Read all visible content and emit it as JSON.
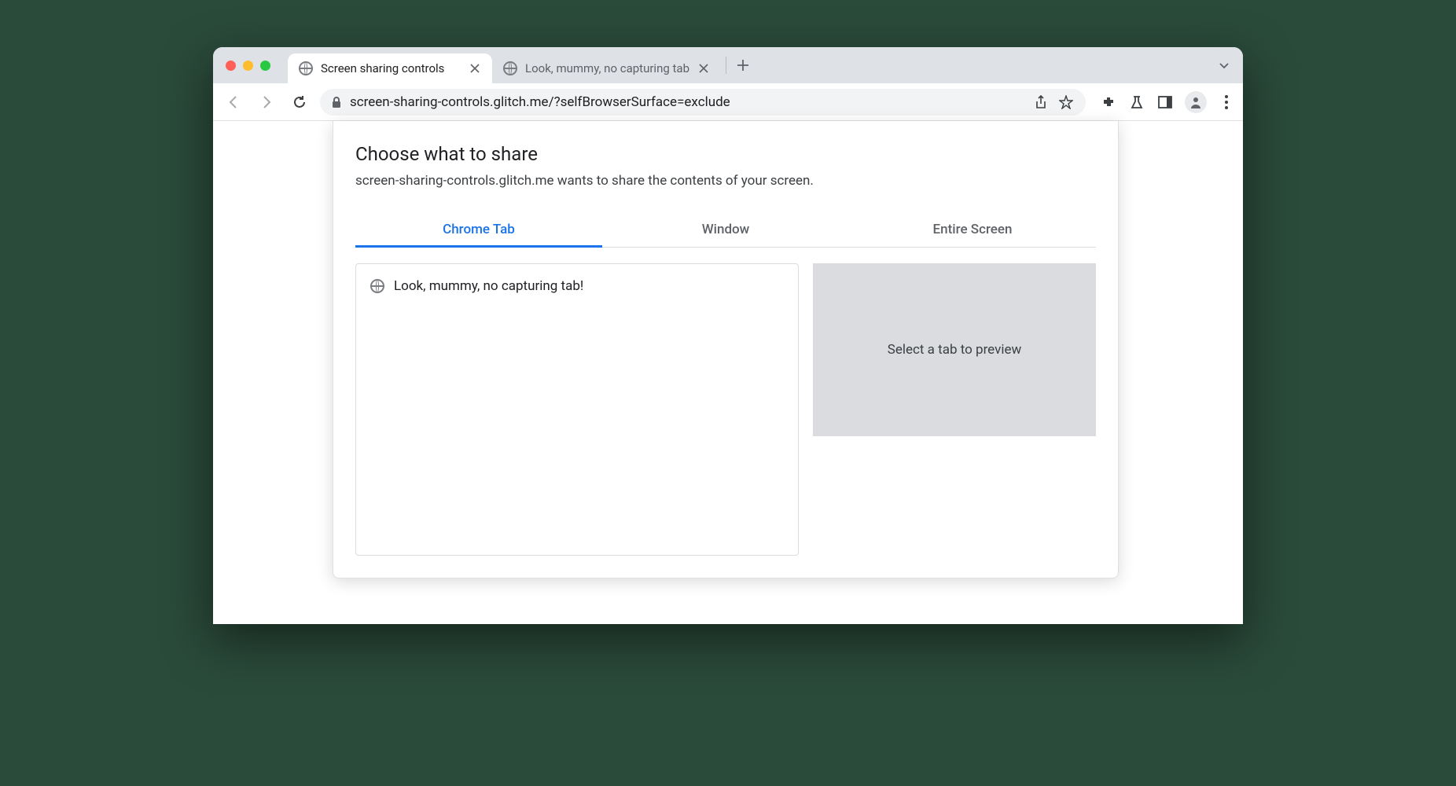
{
  "browser": {
    "tabs": [
      {
        "title": "Screen sharing controls",
        "active": true
      },
      {
        "title": "Look, mummy, no capturing tab",
        "active": false
      }
    ],
    "url": "screen-sharing-controls.glitch.me/?selfBrowserSurface=exclude"
  },
  "dialog": {
    "title": "Choose what to share",
    "subtitle": "screen-sharing-controls.glitch.me wants to share the contents of your screen.",
    "tabs": {
      "chrome_tab": "Chrome Tab",
      "window": "Window",
      "entire_screen": "Entire Screen"
    },
    "list_items": [
      {
        "title": "Look, mummy, no capturing tab!"
      }
    ],
    "preview_placeholder": "Select a tab to preview"
  }
}
